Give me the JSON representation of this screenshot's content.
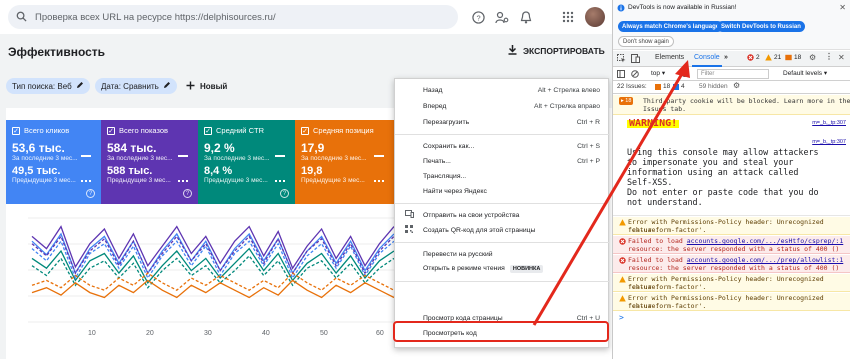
{
  "search": {
    "placeholder": "Проверка всех URL на ресурсе https://delphisources.ru/"
  },
  "header": {
    "title": "Эффективность",
    "export_label": "ЭКСПОРТИРОВАТЬ"
  },
  "filters": {
    "chip1": "Тип поиска: Веб",
    "chip2": "Дата: Сравнить",
    "new_label": "Новый"
  },
  "cards": [
    {
      "title": "Всего кликов",
      "value1": "53,6 тыс.",
      "sub1": "За последние 3 мес...",
      "value2": "49,5 тыс.",
      "sub2": "Предыдущие 3 мес...",
      "color": "#4285f4"
    },
    {
      "title": "Всего показов",
      "value1": "584 тыс.",
      "sub1": "За последние 3 мес...",
      "value2": "588 тыс.",
      "sub2": "Предыдущие 3 мес...",
      "color": "#5e35b1"
    },
    {
      "title": "Средний CTR",
      "value1": "9,2 %",
      "sub1": "За последние 3 мес...",
      "value2": "8,4 %",
      "sub2": "Предыдущие 3 мес...",
      "color": "#00897b"
    },
    {
      "title": "Средняя позиция",
      "value1": "17,9",
      "sub1": "За последние 3 мес...",
      "value2": "19,8",
      "sub2": "Предыдущие 3 мес...",
      "color": "#e8710a"
    }
  ],
  "chart_data": {
    "type": "line",
    "x_ticks": [
      "10",
      "20",
      "30",
      "40",
      "50",
      "60"
    ],
    "series": [
      {
        "color": "#4285f4",
        "dashed": false,
        "values": [
          66,
          55,
          72,
          40,
          60,
          70,
          48,
          66,
          40,
          58,
          72,
          50,
          66,
          42,
          60,
          72,
          50,
          68,
          40,
          58,
          70,
          48,
          66,
          42,
          60,
          72
        ]
      },
      {
        "color": "#5e35b1",
        "dashed": false,
        "values": [
          70,
          60,
          78,
          45,
          64,
          76,
          52,
          72,
          46,
          62,
          78,
          56,
          70,
          48,
          66,
          78,
          54,
          74,
          44,
          62,
          76,
          52,
          70,
          46,
          64,
          78
        ]
      },
      {
        "color": "#00897b",
        "dashed": false,
        "values": [
          52,
          44,
          58,
          34,
          50,
          56,
          40,
          54,
          32,
          46,
          58,
          42,
          52,
          36,
          48,
          60,
          42,
          56,
          34,
          48,
          56,
          40,
          54,
          36,
          50,
          58
        ]
      },
      {
        "color": "#4285f4",
        "dashed": true,
        "values": [
          60,
          50,
          66,
          36,
          56,
          64,
          44,
          62,
          36,
          54,
          66,
          46,
          62,
          38,
          56,
          66,
          46,
          64,
          36,
          54,
          64,
          44,
          62,
          38,
          56,
          66
        ]
      },
      {
        "color": "#5e35b1",
        "dashed": true,
        "values": [
          64,
          54,
          70,
          40,
          58,
          68,
          46,
          66,
          40,
          56,
          70,
          50,
          64,
          42,
          58,
          70,
          48,
          68,
          40,
          58,
          68,
          46,
          64,
          40,
          58,
          70
        ]
      },
      {
        "color": "#00897b",
        "dashed": true,
        "values": [
          46,
          38,
          52,
          30,
          44,
          50,
          36,
          48,
          28,
          42,
          52,
          38,
          46,
          32,
          42,
          54,
          38,
          50,
          30,
          44,
          50,
          36,
          48,
          32,
          44,
          52
        ]
      },
      {
        "color": "#e8710a",
        "dashed": true,
        "values": [
          30,
          34,
          28,
          38,
          30,
          26,
          36,
          30,
          40,
          32,
          26,
          36,
          30,
          38,
          32,
          26,
          34,
          28,
          40,
          32,
          26,
          36,
          30,
          38,
          32,
          26
        ]
      },
      {
        "color": "#e8710a",
        "dashed": false,
        "values": [
          24,
          28,
          22,
          32,
          24,
          20,
          30,
          24,
          34,
          26,
          20,
          30,
          24,
          32,
          26,
          20,
          28,
          22,
          34,
          26,
          20,
          30,
          24,
          32,
          26,
          20
        ]
      }
    ]
  },
  "context_menu": {
    "items": [
      {
        "label": "Назад",
        "shortcut": "Alt + Стрелка влево"
      },
      {
        "label": "Вперед",
        "shortcut": "Alt + Стрелка вправо"
      },
      {
        "label": "Перезагрузить",
        "shortcut": "Ctrl + R"
      },
      {
        "label": "Сохранить как...",
        "shortcut": "Ctrl + S"
      },
      {
        "label": "Печать...",
        "shortcut": "Ctrl + P"
      },
      {
        "label": "Трансляция...",
        "shortcut": ""
      },
      {
        "label": "Найти через Яндекс",
        "shortcut": ""
      },
      {
        "label": "Отправить на свои устройства",
        "shortcut": ""
      },
      {
        "label": "Создать QR-код для этой страницы",
        "shortcut": ""
      },
      {
        "label": "Перевести на русский",
        "shortcut": ""
      },
      {
        "label": "Открыть в режиме чтения",
        "shortcut": "",
        "badge": "НОВИНКА"
      },
      {
        "label": "Просмотр кода страницы",
        "shortcut": "Ctrl + U"
      },
      {
        "label": "Просмотреть код",
        "shortcut": ""
      }
    ]
  },
  "devtools": {
    "banner_text": "DevTools is now available in Russian!",
    "btn_match": "Always match Chrome's language",
    "btn_switch": "Switch DevTools to Russian",
    "btn_dont": "Don't show again",
    "tab_elements": "Elements",
    "tab_console": "Console",
    "err_count": "2",
    "warn_count": "21",
    "info_count": "18",
    "context": "top",
    "filter_placeholder": "Filter",
    "levels": "Default levels",
    "issues_label": "22 Issues:",
    "issues_a": "18",
    "issues_b": "4",
    "hidden": "59 hidden",
    "cookie_badge": "18",
    "cookie_line1": "Third-party cookie will be blocked. Learn more in the",
    "cookie_line2": "Issues tab.",
    "warning_title": "WARNING!",
    "src1": "m=_b,_tp:307",
    "warning_body": [
      "Using this console may allow attackers",
      "to impersonate you and steal your",
      "information using an attack called",
      "Self-XSS.",
      "Do not enter or paste code that you do",
      "not understand."
    ],
    "src2": "m=_b,_tp:307",
    "msg1": [
      "Error with Permissions-Policy header: Unrecognized feature:",
      "'ch-ua-form-factor'."
    ],
    "msg2_prefix": "Failed to load",
    "msg2_link": "accounts.google.com/.../esHtfo/csprep/:1",
    "msg2_rest": "resource: the server responded with a status of 400 ()",
    "msg3_prefix": "Failed to load",
    "msg3_link": "accounts.google.com/.../prep/allowlist:1",
    "msg3_rest": "resource: the server responded with a status of 400 ()",
    "msg4": [
      "Error with Permissions-Policy header: Unrecognized feature:",
      "'ch-ua-form-factor'."
    ],
    "msg5": [
      "Error with Permissions-Policy header: Unrecognized feature:",
      "'ch-ua-form-factor'."
    ],
    "prompt": ">"
  },
  "annotation": {
    "arrow_color": "#e3281c"
  }
}
